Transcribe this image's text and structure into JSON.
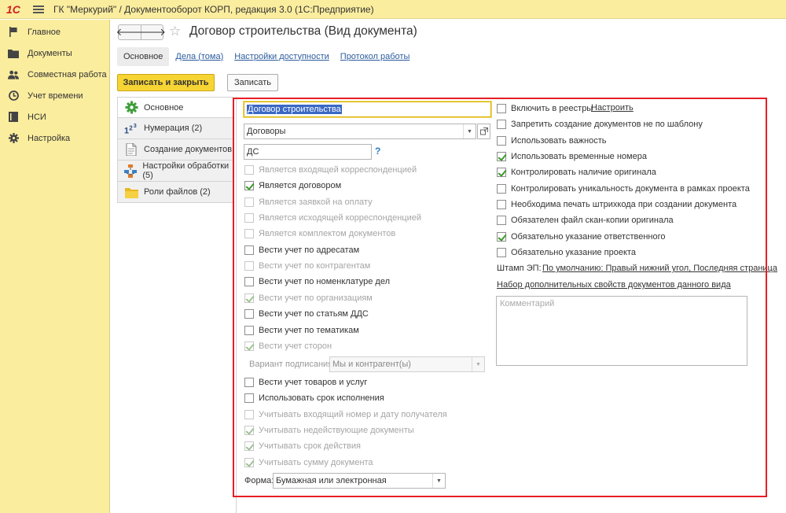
{
  "app": {
    "logo": "1С",
    "title": "ГК \"Меркурий\" / Документооборот КОРП, редакция 3.0  (1С:Предприятие)"
  },
  "sidebar": {
    "items": [
      {
        "label": "Главное",
        "icon": "flag-icon"
      },
      {
        "label": "Документы",
        "icon": "folder-icon"
      },
      {
        "label": "Совместная работа",
        "icon": "people-icon"
      },
      {
        "label": "Учет времени",
        "icon": "clock-icon"
      },
      {
        "label": "НСИ",
        "icon": "book-icon"
      },
      {
        "label": "Настройка",
        "icon": "gear-icon"
      }
    ]
  },
  "header": {
    "back": "🡐",
    "forward": "🡒",
    "star": "☆",
    "title": "Договор строительства (Вид документа)"
  },
  "tabs": [
    {
      "label": "Основное",
      "active": true
    },
    {
      "label": "Дела (тома)",
      "active": false
    },
    {
      "label": "Настройки доступности",
      "active": false
    },
    {
      "label": "Протокол работы",
      "active": false
    }
  ],
  "toolbar": {
    "save_close": "Записать и закрыть",
    "save": "Записать"
  },
  "form_nav": [
    {
      "label": "Основное",
      "icon": "gear-green-icon"
    },
    {
      "label": "Нумерация (2)",
      "icon": "numbering-icon"
    },
    {
      "label": "Создание документов",
      "icon": "document-icon"
    },
    {
      "label": "Настройки обработки (5)",
      "icon": "workflow-icon"
    },
    {
      "label": "Роли файлов (2)",
      "icon": "folder-icon"
    }
  ],
  "form": {
    "name": "Договор строительства",
    "group": "Договоры",
    "code": "ДС",
    "help": "?",
    "left_checks": [
      {
        "label": "Является входящей корреспонденцией",
        "checked": false,
        "disabled": true
      },
      {
        "label": "Является договором",
        "checked": true,
        "disabled": false
      },
      {
        "label": "Является заявкой на оплату",
        "checked": false,
        "disabled": true
      },
      {
        "label": "Является исходящей корреспонденцией",
        "checked": false,
        "disabled": true
      },
      {
        "label": "Является комплектом документов",
        "checked": false,
        "disabled": true
      },
      {
        "label": "Вести учет по адресатам",
        "checked": false,
        "disabled": false
      },
      {
        "label": "Вести учет по контрагентам",
        "checked": false,
        "disabled": true
      },
      {
        "label": "Вести учет по номенклатуре дел",
        "checked": false,
        "disabled": false
      },
      {
        "label": "Вести учет по организациям",
        "checked": true,
        "disabled": true
      },
      {
        "label": "Вести учет по статьям ДДС",
        "checked": false,
        "disabled": false
      },
      {
        "label": "Вести учет по тематикам",
        "checked": false,
        "disabled": false
      },
      {
        "label": "Вести учет сторон",
        "checked": true,
        "disabled": true
      }
    ],
    "signing_label": "Вариант подписания:",
    "signing_value": "Мы и контрагент(ы)",
    "left_checks2": [
      {
        "label": "Вести учет товаров и услуг",
        "checked": false,
        "disabled": false
      },
      {
        "label": "Использовать срок исполнения",
        "checked": false,
        "disabled": false
      },
      {
        "label": "Учитывать входящий номер и дату получателя",
        "checked": false,
        "disabled": true
      },
      {
        "label": "Учитывать недействующие документы",
        "checked": true,
        "disabled": true
      },
      {
        "label": "Учитывать срок действия",
        "checked": true,
        "disabled": true
      },
      {
        "label": "Учитывать сумму документа",
        "checked": true,
        "disabled": true
      }
    ],
    "form_label": "Форма:",
    "form_value": "Бумажная или электронная",
    "right_checks": [
      {
        "label": "Включить в реестры",
        "checked": false,
        "disabled": false
      },
      {
        "label": "Запретить создание документов не по шаблону",
        "checked": false,
        "disabled": false
      },
      {
        "label": "Использовать важность",
        "checked": false,
        "disabled": false
      },
      {
        "label": "Использовать временные номера",
        "checked": true,
        "disabled": false
      },
      {
        "label": "Контролировать наличие оригинала",
        "checked": true,
        "disabled": false
      },
      {
        "label": "Контролировать уникальность документа в рамках проекта",
        "checked": false,
        "disabled": false
      },
      {
        "label": "Необходима печать штрихкода при создании документа",
        "checked": false,
        "disabled": false
      },
      {
        "label": "Обязателен файл скан-копии оригинала",
        "checked": false,
        "disabled": false
      },
      {
        "label": "Обязательно указание ответственного",
        "checked": true,
        "disabled": false
      },
      {
        "label": "Обязательно указание проекта",
        "checked": false,
        "disabled": false
      }
    ],
    "registry_link": "Настроить",
    "stamp_label": "Штамп ЭП:",
    "stamp_link": "По умолчанию: Правый нижний угол, Последняя страница",
    "props_link": "Набор дополнительных свойств документов данного вида",
    "comment_placeholder": "Комментарий"
  }
}
